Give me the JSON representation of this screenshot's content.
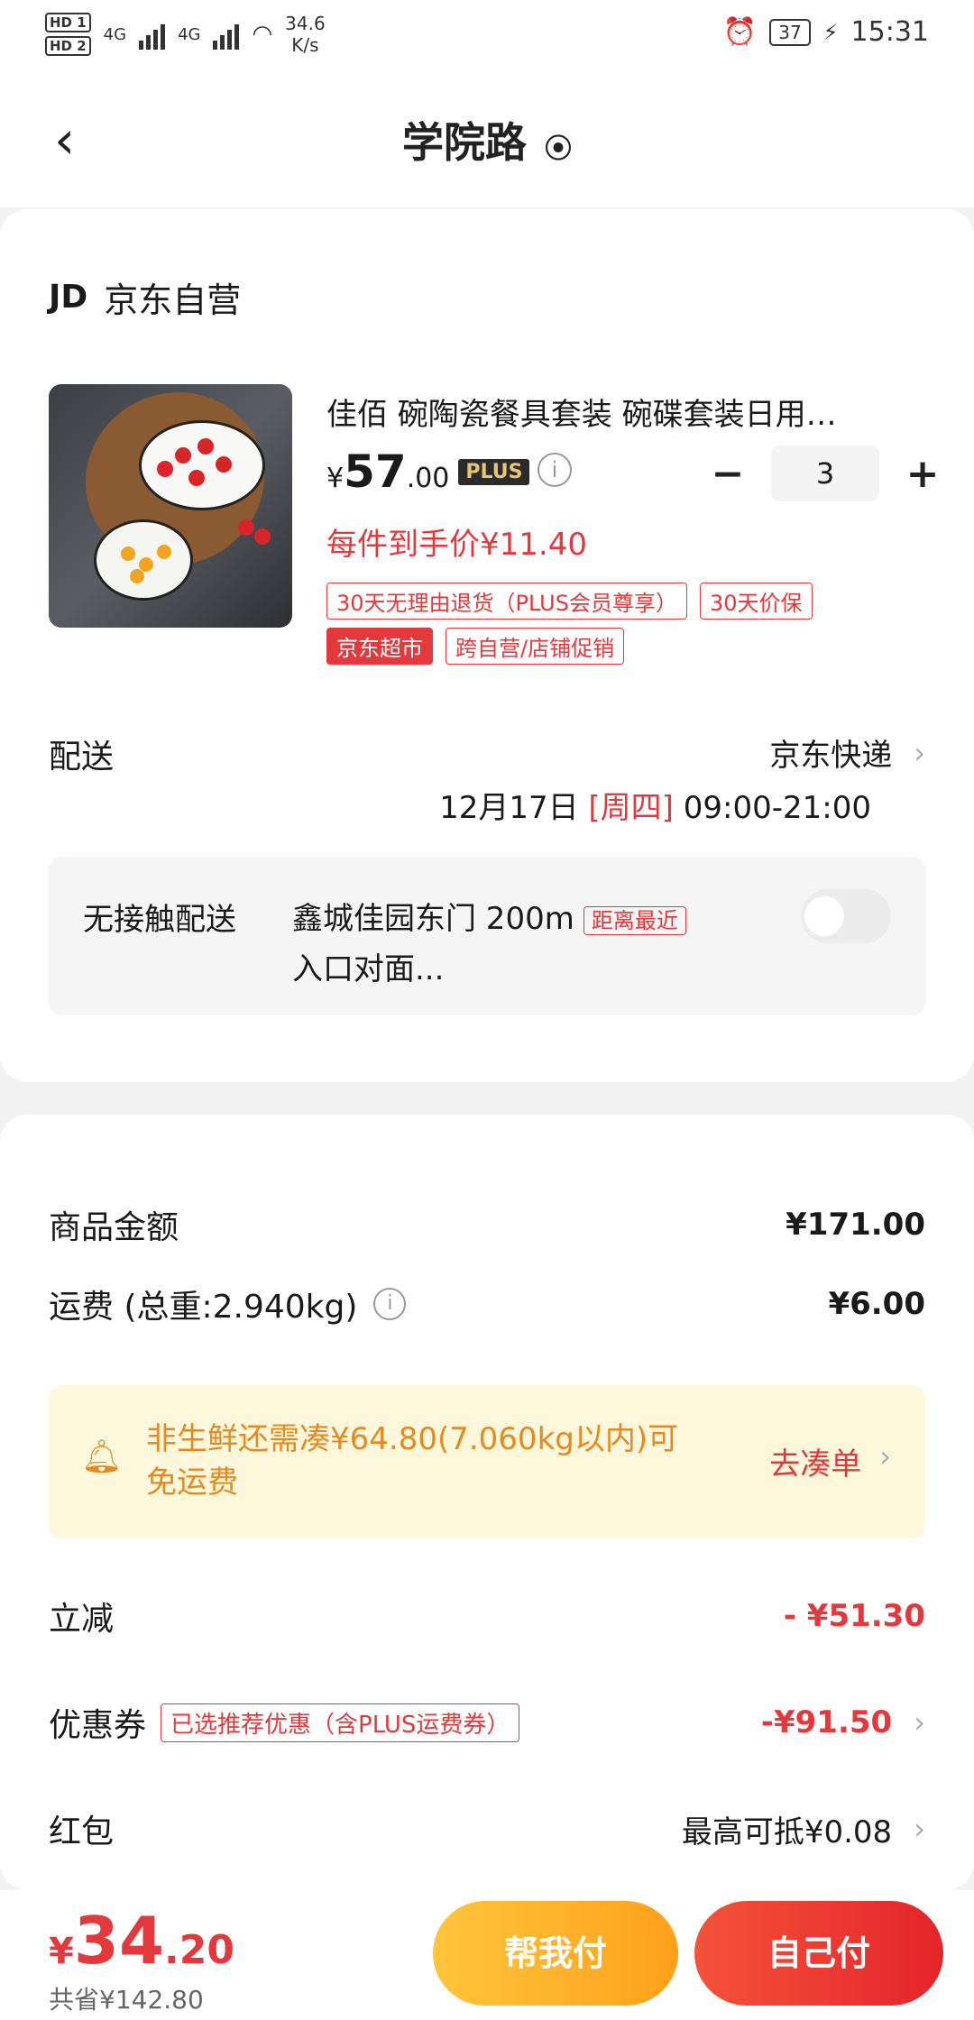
{
  "status_bar": {
    "hd1": "HD 1",
    "hd2": "HD 2",
    "net1": "4G",
    "net2": "4G",
    "speed_value": "34.6",
    "speed_unit": "K/s",
    "battery": "37",
    "time": "15:31"
  },
  "nav": {
    "back_icon": "chevron-left-icon",
    "title": "学院路",
    "location_icon": "location-pin-icon"
  },
  "store": {
    "logo_text": "JD",
    "name": "京东自营"
  },
  "product": {
    "name": "佳佰 碗陶瓷餐具套装 碗碟套装日用…",
    "price_symbol": "¥",
    "price_int": "57",
    "price_dec": ".00",
    "plus_badge": "PLUS",
    "quantity": "3",
    "minus_label": "−",
    "plus_label": "+",
    "per_item_price": "每件到手价¥11.40",
    "tags_row1": [
      "30天无理由退货（PLUS会员尊享）",
      "30天价保"
    ],
    "tags_row2_solid": "京东超市",
    "tags_row2": "跨自营/店铺促销"
  },
  "shipping": {
    "label": "配送",
    "carrier": "京东快递",
    "date": "12月17日 ",
    "weekday": "[周四]",
    "time_window": " 09:00-21:00"
  },
  "contactless": {
    "label": "无接触配送",
    "address": "鑫城佳园东门  200m",
    "nearest_tag": "距离最近",
    "address_line2": "入口对面...",
    "toggle_on": false
  },
  "summary": {
    "goods_label": "商品金额",
    "goods_value": "¥171.00",
    "freight_label": "运费 (总重:2.940kg)",
    "freight_value": "¥6.00",
    "notice_text": "非生鲜还需凑¥64.80(7.060kg以内)可免运费",
    "notice_action": "去凑单",
    "discount_label": "立减",
    "discount_value": "- ¥51.30",
    "coupon_label": "优惠券",
    "coupon_tag": "已选推荐优惠（含PLUS运费券）",
    "coupon_value": "-¥91.50",
    "redpacket_label": "红包",
    "redpacket_value": "最高可抵¥0.08"
  },
  "bottom": {
    "total_symbol": "¥",
    "total_int": "34",
    "total_dec": ".20",
    "saved": "共省¥142.80",
    "help_pay": "帮我付",
    "self_pay": "自己付"
  },
  "colors": {
    "accent_red": "#e4393c",
    "notice_bg": "#fdf7dc",
    "notice_text": "#e58a1f",
    "help_btn": "#ffb020",
    "self_btn": "#e9322b"
  }
}
